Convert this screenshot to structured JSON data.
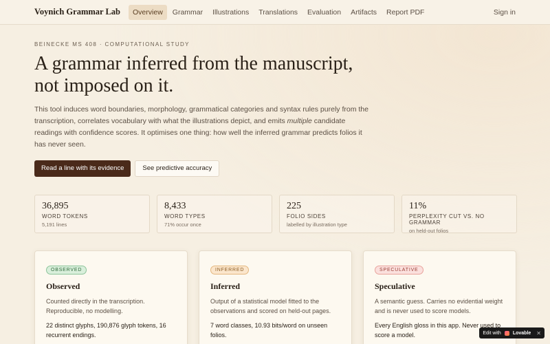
{
  "nav": {
    "brand": "Voynich Grammar Lab",
    "links": [
      "Overview",
      "Grammar",
      "Illustrations",
      "Translations",
      "Evaluation",
      "Artifacts",
      "Report PDF"
    ],
    "active_index": 0,
    "signin": "Sign in"
  },
  "hero": {
    "eyebrow": "BEINECKE MS 408 · COMPUTATIONAL STUDY",
    "title_line1": "A grammar inferred from the manuscript,",
    "title_line2": "not imposed on it.",
    "lede_part1": "This tool induces word boundaries, morphology, grammatical categories and syntax rules purely from the transcription, correlates vocabulary with what the illustrations depict, and emits ",
    "lede_em": "multiple",
    "lede_part2": " candidate readings with confidence scores. It optimises one thing: how well the inferred grammar predicts folios it has never seen.",
    "primary_button": "Read a line with its evidence",
    "secondary_button": "See predictive accuracy"
  },
  "stats": [
    {
      "value": "36,895",
      "label": "WORD TOKENS",
      "sub": "5,191 lines"
    },
    {
      "value": "8,433",
      "label": "WORD TYPES",
      "sub": "71% occur once"
    },
    {
      "value": "225",
      "label": "FOLIO SIDES",
      "sub": "labelled by illustration type"
    },
    {
      "value": "11%",
      "label": "PERPLEXITY CUT VS. NO GRAMMAR",
      "sub": "on held-out folios"
    }
  ],
  "cards": [
    {
      "badge": "OBSERVED",
      "title": "Observed",
      "desc": "Counted directly in the transcription. Reproducible, no modelling.",
      "fact": "22 distinct glyphs, 190,876 glyph tokens, 16 recurrent endings."
    },
    {
      "badge": "INFERRED",
      "title": "Inferred",
      "desc": "Output of a statistical model fitted to the observations and scored on held-out pages.",
      "fact": "7 word classes, 10.93 bits/word on unseen folios."
    },
    {
      "badge": "SPECULATIVE",
      "title": "Speculative",
      "desc": "A semantic guess. Carries no evidential weight and is never used to score models.",
      "fact": "Every English gloss in this app. Never used to score a model."
    }
  ],
  "lovable": {
    "prefix": "Edit with",
    "name": "Lovable",
    "close": "✕"
  }
}
